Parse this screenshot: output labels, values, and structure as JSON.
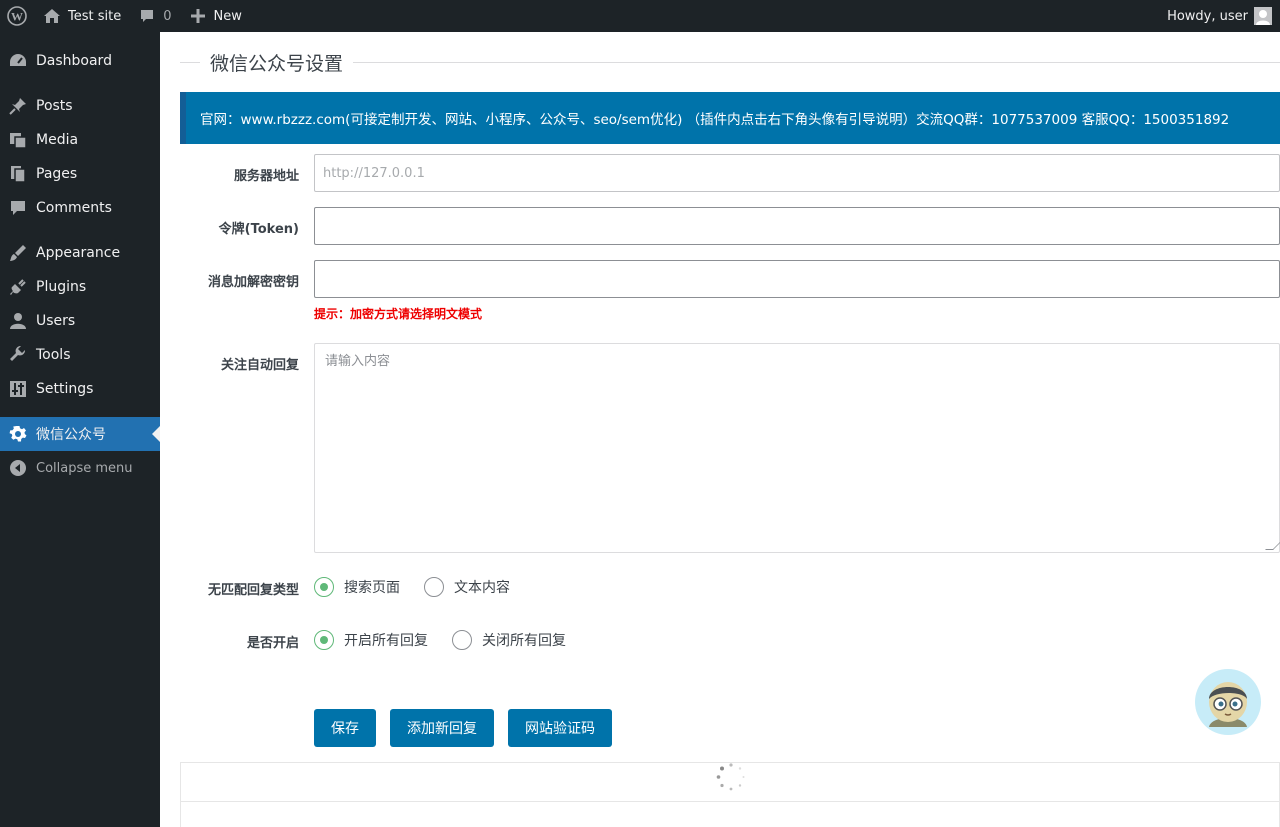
{
  "adminbar": {
    "site_name": "Test site",
    "comments_count": "0",
    "new_label": "New",
    "howdy": "Howdy, user"
  },
  "sidebar": {
    "items": [
      {
        "label": "Dashboard",
        "icon": "dashboard-icon"
      },
      {
        "label": "Posts",
        "icon": "pin-icon"
      },
      {
        "label": "Media",
        "icon": "media-icon"
      },
      {
        "label": "Pages",
        "icon": "pages-icon"
      },
      {
        "label": "Comments",
        "icon": "comment-icon"
      },
      {
        "label": "Appearance",
        "icon": "brush-icon"
      },
      {
        "label": "Plugins",
        "icon": "plug-icon"
      },
      {
        "label": "Users",
        "icon": "user-icon"
      },
      {
        "label": "Tools",
        "icon": "wrench-icon"
      },
      {
        "label": "Settings",
        "icon": "settings-icon"
      },
      {
        "label": "微信公众号",
        "icon": "gear-icon"
      }
    ],
    "collapse_label": "Collapse menu",
    "active_color": "#2271b1"
  },
  "page": {
    "title": "微信公众号设置",
    "notice": "官网：www.rbzzz.com(可接定制开发、网站、小程序、公众号、seo/sem优化) （插件内点击右下角头像有引导说明）交流QQ群：1077537009 客服QQ：1500351892"
  },
  "form": {
    "server_label": "服务器地址",
    "server_value": "http://127.0.0.1",
    "token_label": "令牌(Token)",
    "token_value": "",
    "aes_label": "消息加解密密钥",
    "aes_value": "",
    "aes_hint": "提示：加密方式请选择明文模式",
    "autoreply_label": "关注自动回复",
    "autoreply_placeholder": "请输入内容",
    "nomatch_label": "无匹配回复类型",
    "nomatch_options": [
      "搜索页面",
      "文本内容"
    ],
    "nomatch_selected": "搜索页面",
    "enable_label": "是否开启",
    "enable_options": [
      "开启所有回复",
      "关闭所有回复"
    ],
    "enable_selected": "开启所有回复"
  },
  "buttons": {
    "save": "保存",
    "add_reply": "添加新回复",
    "verify": "网站验证码"
  },
  "colors": {
    "primary": "#0073aa",
    "radio_checked": "#5fb878",
    "hint": "#ee0000"
  }
}
